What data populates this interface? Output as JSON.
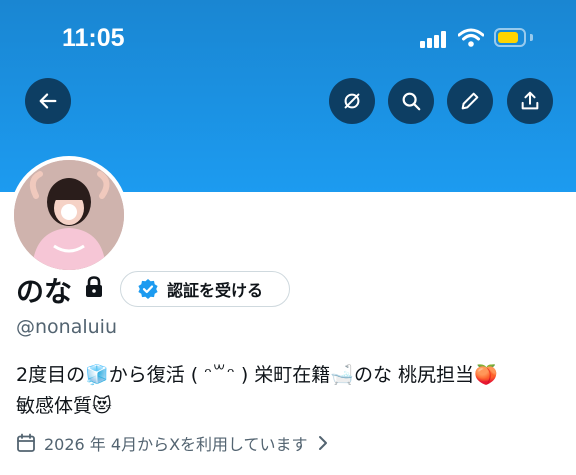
{
  "status_bar": {
    "time": "11:05"
  },
  "header": {
    "back_icon": "arrow-left-icon",
    "actions": [
      "mute-icon",
      "search-icon",
      "edit-icon",
      "share-icon"
    ]
  },
  "profile": {
    "display_name": "のな",
    "protected_icon": "lock-icon",
    "verify_button_label": "認証を受ける",
    "handle": "@nonaluiu",
    "bio_line1": "2度目の🧊から復活 ( ᵔ꒳ᵔ ) 栄町在籍🛁のな 桃尻担当🍑",
    "bio_line2": "敏感体質😻",
    "joined": "2026 年 4月からXを利用しています"
  },
  "colors": {
    "banner": "#1c9bf0",
    "dark_button": "#0d3e63",
    "verified": "#1d9bf0"
  }
}
